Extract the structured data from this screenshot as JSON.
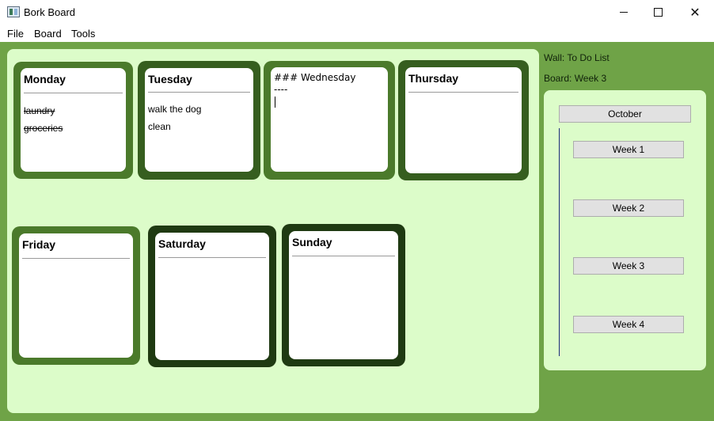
{
  "window": {
    "title": "Bork Board",
    "icon": "app-window-icon"
  },
  "menu": [
    {
      "label": "File"
    },
    {
      "label": "Board"
    },
    {
      "label": "Tools"
    }
  ],
  "cards": {
    "monday": {
      "title": "Monday",
      "lines": [
        "laundry",
        "groceries"
      ],
      "status": "strikethrough",
      "frame_color": "#4b7a2b"
    },
    "tuesday": {
      "title": "Tuesday",
      "lines": [
        "walk the dog",
        "clean"
      ],
      "frame_color": "#365e1f"
    },
    "wednesday": {
      "raw_lines": [
        "### Wednesday",
        "----"
      ],
      "mode": "editing",
      "frame_color": "#4b7a2b"
    },
    "thursday": {
      "title": "Thursday",
      "frame_color": "#365e1f"
    },
    "friday": {
      "title": "Friday",
      "frame_color": "#4b7a2b"
    },
    "saturday": {
      "title": "Saturday",
      "frame_color": "#1f3a12"
    },
    "sunday": {
      "title": "Sunday",
      "frame_color": "#1f3a12"
    }
  },
  "sidebar": {
    "wall_label": "Wall: To Do List",
    "board_label": "Board: Week 3",
    "month_button": "October",
    "weeks": [
      "Week 1",
      "Week 2",
      "Week 3",
      "Week 4"
    ]
  },
  "colors": {
    "background": "#6fa347",
    "board_area": "#dcfcc9",
    "tree_line": "#1c2b7a"
  }
}
